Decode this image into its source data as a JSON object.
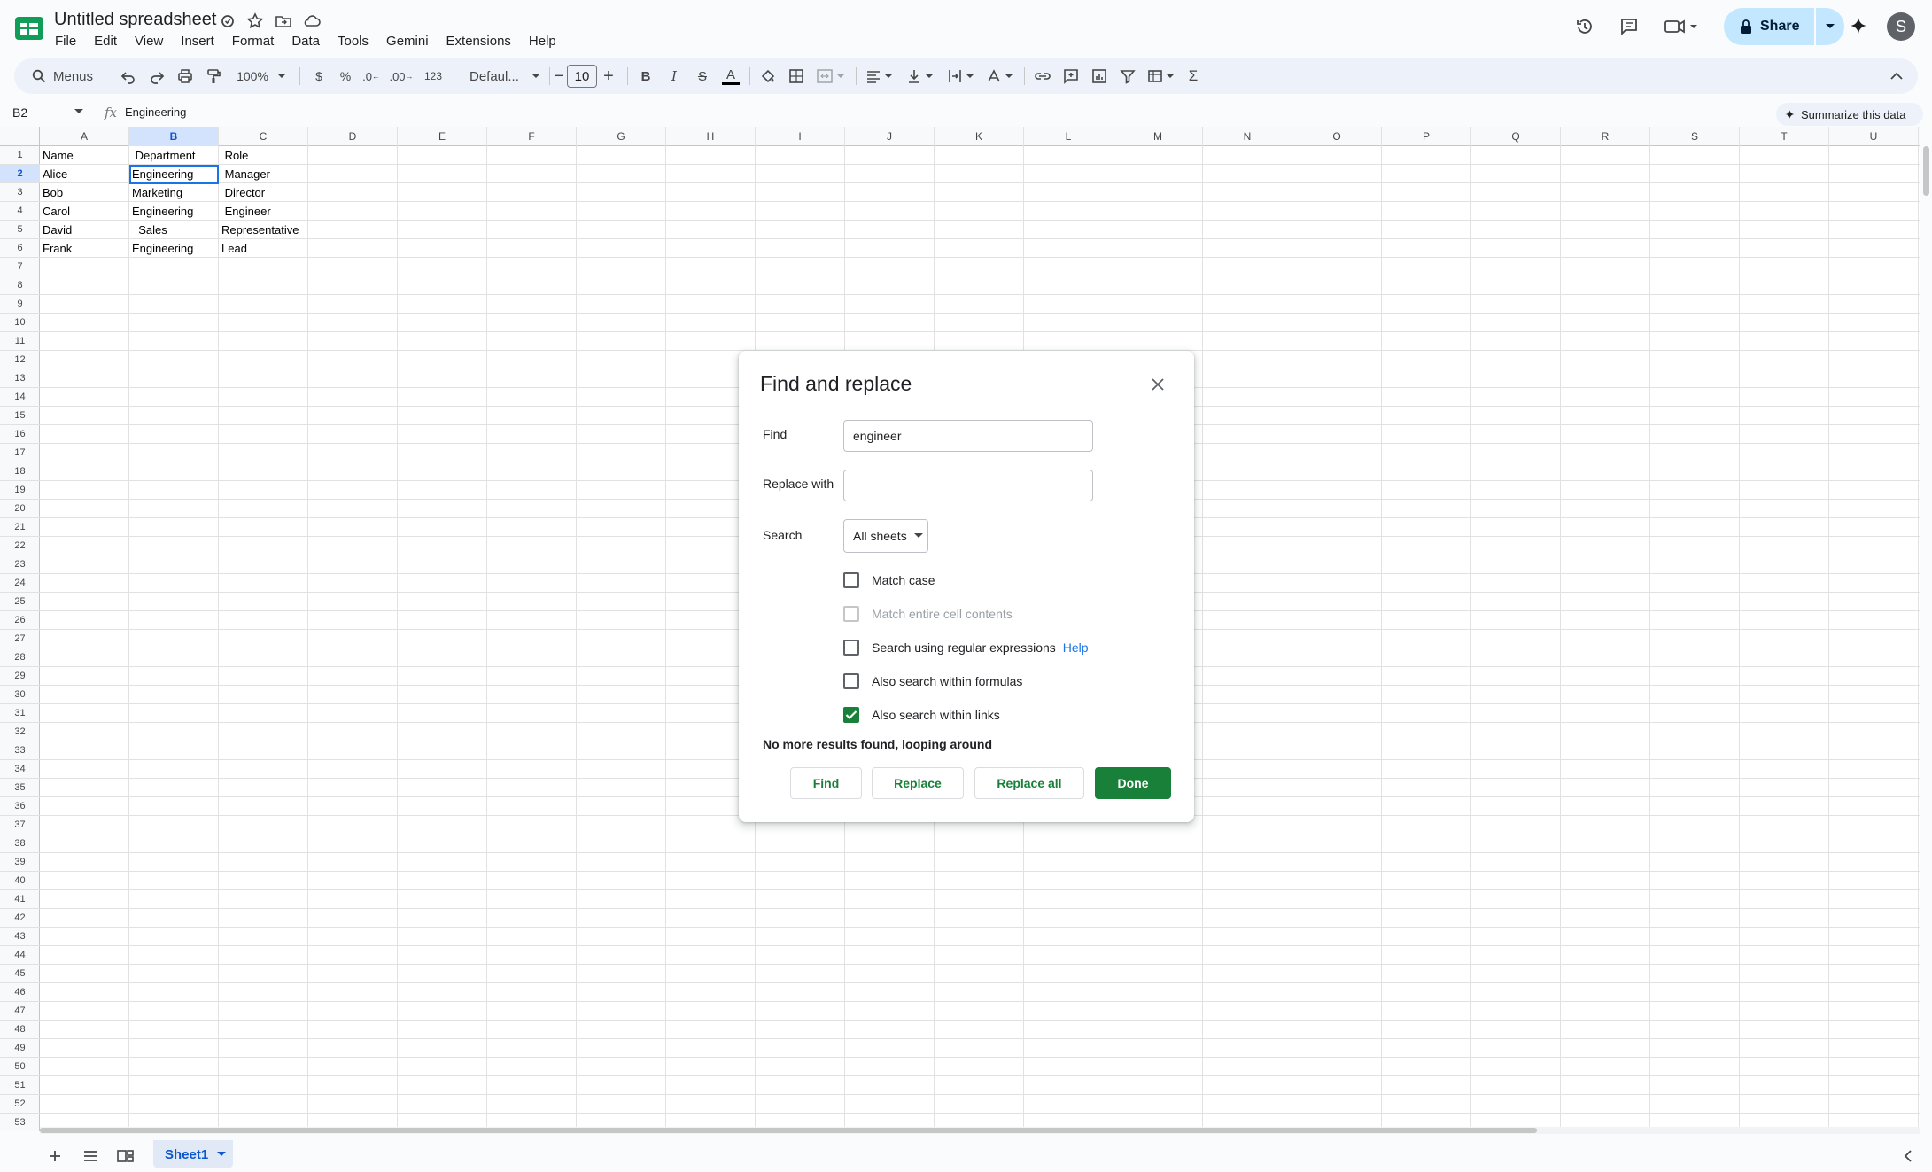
{
  "doc": {
    "title": "Untitled spreadsheet"
  },
  "menu": [
    "File",
    "Edit",
    "View",
    "Insert",
    "Format",
    "Data",
    "Tools",
    "Gemini",
    "Extensions",
    "Help"
  ],
  "share": {
    "label": "Share"
  },
  "avatar": {
    "initial": "S"
  },
  "toolbar": {
    "menus_placeholder": "Menus",
    "zoom": "100%",
    "currency": "$",
    "percent": "%",
    "decrease_decimal": ".0",
    "increase_decimal": ".00",
    "number_format": "123",
    "font": "Defaul...",
    "font_size": "10",
    "bold": "B",
    "italic": "I",
    "strike": "S",
    "text_color": "A",
    "function": "Σ"
  },
  "formula_bar": {
    "cell_ref": "B2",
    "fx": "fx",
    "value": "Engineering",
    "summarize_label": "Summarize this data"
  },
  "grid": {
    "columns": [
      "A",
      "B",
      "C",
      "D",
      "E",
      "F",
      "G",
      "H",
      "I",
      "J",
      "K",
      "L",
      "M",
      "N",
      "O",
      "P",
      "Q",
      "R",
      "S",
      "T",
      "U"
    ],
    "selected_column": "B",
    "selected_row": 2,
    "row_count": 53,
    "cells": [
      [
        "Name",
        " Department",
        " Role"
      ],
      [
        "Alice",
        "Engineering",
        " Manager"
      ],
      [
        "Bob",
        "Marketing",
        " Director"
      ],
      [
        "Carol",
        "Engineering",
        " Engineer"
      ],
      [
        "David",
        "  Sales",
        "Representative"
      ],
      [
        "Frank",
        "Engineering",
        "Lead"
      ]
    ]
  },
  "sheets": {
    "active": "Sheet1"
  },
  "dialog": {
    "title": "Find and replace",
    "find_label": "Find",
    "find_value": "engineer",
    "replace_label": "Replace with",
    "replace_value": "",
    "search_label": "Search",
    "search_scope": "All sheets",
    "options": [
      {
        "label": "Match case",
        "checked": false,
        "disabled": false
      },
      {
        "label": "Match entire cell contents",
        "checked": false,
        "disabled": true
      },
      {
        "label": "Search using regular expressions",
        "checked": false,
        "disabled": false,
        "link": "Help"
      },
      {
        "label": "Also search within formulas",
        "checked": false,
        "disabled": false
      },
      {
        "label": "Also search within links",
        "checked": true,
        "disabled": false
      }
    ],
    "status": "No more results found, looping around",
    "buttons": {
      "find": "Find",
      "replace": "Replace",
      "replace_all": "Replace all",
      "done": "Done"
    }
  },
  "colors": {
    "accent": "#188038",
    "selection": "#1a73e8",
    "share_bg": "#c2e7ff"
  }
}
